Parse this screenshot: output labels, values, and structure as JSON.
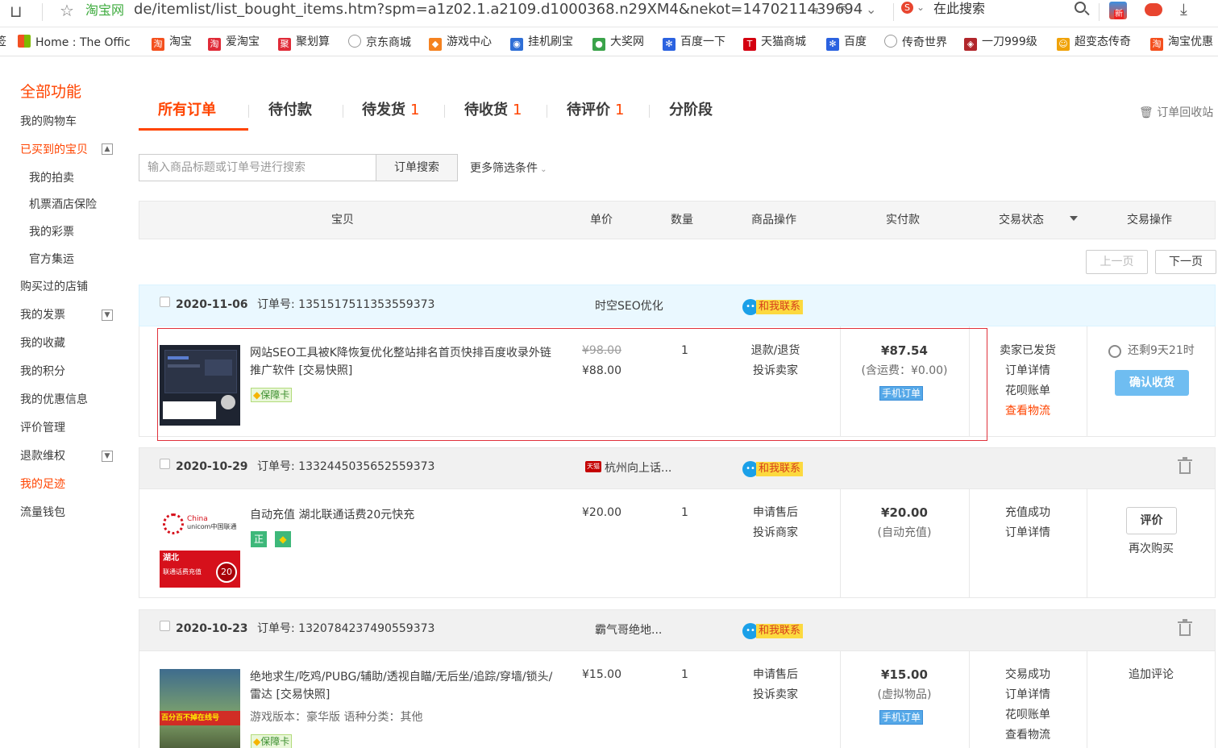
{
  "browser": {
    "site_name": "淘宝网",
    "url": "de/itemlist/list_bought_items.htm?spm=a1z02.1.a2109.d1000368.n29XM4&nekot=1470211439694",
    "search_placeholder": "在此搜索",
    "badge": "新"
  },
  "bookmarks": [
    {
      "label": "Home : The Offic",
      "icon": "office-icon",
      "color": "#e5452f"
    },
    {
      "label": "淘宝",
      "icon": "taobao-icon",
      "color": "#f4501e",
      "glyph": "淘"
    },
    {
      "label": "爱淘宝",
      "icon": "aitaobao-icon",
      "color": "#e02b38",
      "glyph": "淘"
    },
    {
      "label": "聚划算",
      "icon": "juhuasuan-icon",
      "color": "#e02b38",
      "glyph": "聚"
    },
    {
      "label": "京东商城",
      "icon": "globe-icon",
      "color": "#ffffff",
      "glyph": "◯"
    },
    {
      "label": "游戏中心",
      "icon": "gamepad-icon",
      "color": "#f58220",
      "glyph": "◆"
    },
    {
      "label": "挂机刷宝",
      "icon": "ie-icon",
      "color": "#2f6fd6",
      "glyph": "◉"
    },
    {
      "label": "大奖网",
      "icon": "ball-icon",
      "color": "#3aa34a",
      "glyph": "●"
    },
    {
      "label": "百度一下",
      "icon": "baidu-paw-icon",
      "color": "#2b62e0",
      "glyph": "✻"
    },
    {
      "label": "天猫商城",
      "icon": "tmall-icon",
      "color": "#d40010",
      "glyph": "T"
    },
    {
      "label": "百度",
      "icon": "baidu-paw-icon",
      "color": "#2b62e0",
      "glyph": "✻"
    },
    {
      "label": "传奇世界",
      "icon": "globe-icon",
      "color": "#ffffff",
      "glyph": "◯"
    },
    {
      "label": "一刀999级",
      "icon": "game-icon",
      "color": "#b1262b",
      "glyph": "◈"
    },
    {
      "label": "超变态传奇",
      "icon": "game2-icon",
      "color": "#f0a30a",
      "glyph": "☺"
    },
    {
      "label": "淘宝优惠",
      "icon": "taobao-icon",
      "color": "#f4501e",
      "glyph": "淘"
    }
  ],
  "sidebar": {
    "title": "全部功能",
    "items": [
      {
        "label": "我的购物车"
      },
      {
        "label": "已买到的宝贝",
        "active": true
      },
      {
        "label": "我的拍卖"
      },
      {
        "label": "机票酒店保险"
      },
      {
        "label": "我的彩票"
      },
      {
        "label": "官方集运"
      },
      {
        "label": "购买过的店铺"
      },
      {
        "label": "我的发票"
      },
      {
        "label": "我的收藏"
      },
      {
        "label": "我的积分"
      },
      {
        "label": "我的优惠信息"
      },
      {
        "label": "评价管理"
      },
      {
        "label": "退款维权"
      },
      {
        "label": "我的足迹",
        "active": true
      },
      {
        "label": "流量钱包"
      }
    ]
  },
  "tabs": [
    {
      "label": "所有订单",
      "count": ""
    },
    {
      "label": "待付款",
      "count": ""
    },
    {
      "label": "待发货",
      "count": "1"
    },
    {
      "label": "待收货",
      "count": "1"
    },
    {
      "label": "待评价",
      "count": "1"
    },
    {
      "label": "分阶段",
      "count": ""
    }
  ],
  "recycle_label": "订单回收站",
  "search": {
    "placeholder": "输入商品标题或订单号进行搜索",
    "button": "订单搜索",
    "more_filters": "更多筛选条件"
  },
  "columns": [
    "宝贝",
    "单价",
    "数量",
    "商品操作",
    "实付款",
    "交易状态",
    "交易操作"
  ],
  "pager": {
    "prev": "上一页",
    "next": "下一页"
  },
  "contact_label": "和我联系",
  "orders": [
    {
      "date": "2020-11-06",
      "order_no_label": "订单号:",
      "order_no": "1351517511353559373",
      "shop": "时空SEO优化",
      "title": "网站SEO工具被K降恢复优化整站排名首页快排百度收录外链推广软件 [交易快照]",
      "tags": [
        "保障卡"
      ],
      "price_original": "¥98.00",
      "price": "¥88.00",
      "qty": "1",
      "ops": [
        "退款/退货",
        "投诉卖家"
      ],
      "paid": "¥87.54",
      "paid_note": "(含运费：¥0.00)",
      "mobile_tag": "手机订单",
      "status": [
        "卖家已发货",
        "订单详情",
        "花呗账单",
        "查看物流"
      ],
      "countdown": "还剩9天21时",
      "action_button": "确认收货"
    },
    {
      "date": "2020-10-29",
      "order_no_label": "订单号:",
      "order_no": "1332445035652559373",
      "shop": "杭州向上话...",
      "shop_badge": "天猫",
      "title": "自动充值 湖北联通话费20元快充",
      "tags": [
        "正"
      ],
      "price": "¥20.00",
      "qty": "1",
      "ops": [
        "申请售后",
        "投诉商家"
      ],
      "paid": "¥20.00",
      "paid_note": "(自动充值)",
      "status": [
        "充值成功",
        "订单详情"
      ],
      "action_button": "评价",
      "action_link": "再次购买",
      "thumb_text": [
        "China",
        "unicom中国联通",
        "湖北",
        "联通话费充值",
        "20"
      ]
    },
    {
      "date": "2020-10-23",
      "order_no_label": "订单号:",
      "order_no": "1320784237490559373",
      "shop": "霸气哥绝地...",
      "title": "绝地求生/吃鸡/PUBG/辅助/透视自瞄/无后坐/追踪/穿墙/锁头/雷达 [交易快照]",
      "sku": "游戏版本：豪华版  语种分类：其他",
      "tags": [
        "保障卡"
      ],
      "price": "¥15.00",
      "qty": "1",
      "ops": [
        "申请售后",
        "投诉卖家"
      ],
      "paid": "¥15.00",
      "paid_note": "(虚拟物品)",
      "mobile_tag": "手机订单",
      "status": [
        "交易成功",
        "订单详情",
        "花呗账单",
        "查看物流"
      ],
      "action_link": "追加评论",
      "thumb_text": [
        "百分百不掉在线号"
      ]
    }
  ]
}
